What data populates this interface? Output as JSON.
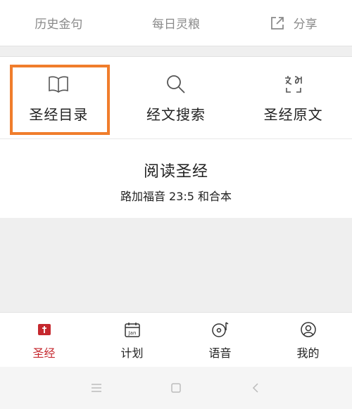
{
  "top_actions": [
    {
      "label": "历史金句"
    },
    {
      "label": "每日灵粮"
    },
    {
      "label": "分享"
    }
  ],
  "tools": [
    {
      "label": "圣经目录",
      "icon": "book-open-icon"
    },
    {
      "label": "经文搜索",
      "icon": "search-icon"
    },
    {
      "label": "圣经原文",
      "icon": "translate-icon"
    }
  ],
  "reading": {
    "title": "阅读圣经",
    "subtitle": "路加福音 23:5 和合本"
  },
  "tabs": [
    {
      "label": "圣经",
      "icon": "bible-icon",
      "active": true
    },
    {
      "label": "计划",
      "icon": "calendar-icon",
      "icon_text": "Jan"
    },
    {
      "label": "语音",
      "icon": "music-disc-icon"
    },
    {
      "label": "我的",
      "icon": "profile-icon"
    }
  ],
  "colors": {
    "accent": "#c5282e",
    "highlight": "#f07d2c",
    "muted": "#8a8a8a"
  }
}
